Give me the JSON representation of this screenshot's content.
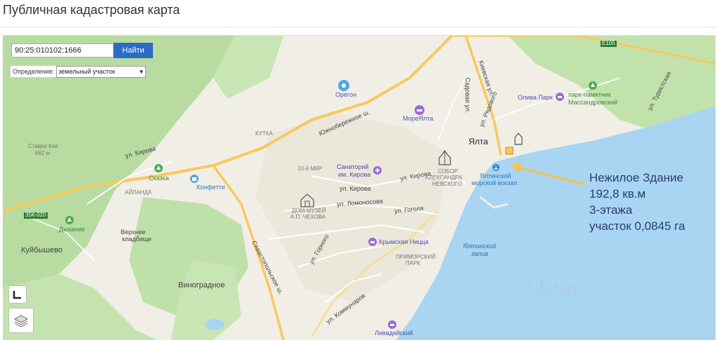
{
  "page": {
    "title": "Публичная кадастровая карта"
  },
  "search": {
    "value": "90:25:010102:1666",
    "button": "Найти"
  },
  "definition": {
    "label": "Определение:",
    "selected": "земельный участок"
  },
  "annotation": {
    "lines": [
      "Нежилое Здание",
      "192,8 кв.м",
      "3-этажа",
      "участок 0,0845 га"
    ]
  },
  "map_labels": {
    "yalta": "Ялта",
    "oregon": "Орегон",
    "more_yalta": "МореЯлта",
    "oliva_park": "Олива Парк",
    "massandra_1": "парк-памятник",
    "massandra_2": "Массандровский",
    "sanatorium_1": "Санаторий",
    "sanatorium_2": "им. Кирова",
    "sobor_1": "СОБОР",
    "sobor_2": "АЛЕКСАНДРА",
    "sobor_3": "НЕВСКОГО",
    "port_1": "Ялтинский",
    "port_2": "морской вокзал",
    "chekhov_1": "ДОМ-МУЗЕЙ",
    "chekhov_2": "А.П. ЧЕХОВА",
    "konfetti": "Конфетти",
    "skazka": "Сказка",
    "dykhanie": "Дыхание",
    "cemetery_1": "Верхнее",
    "cemetery_2": "кладбище",
    "kuibyshevo": "Куйбышево",
    "vinogradnoe": "Виноградное",
    "stavri_1": "Ставри Кая",
    "stavri_2": "662 м",
    "krymskaya_nitsa": "Крымская Ницца",
    "bay_1": "Ялтинский",
    "bay_2": "залив",
    "primorsky_1": "ПРИМОРСКИЙ",
    "primorsky_2": "ПАРК",
    "livadia": "Ливадийский",
    "ul_kirova_1": "ул. Кирова",
    "ul_kirova_2": "ул. Кирова",
    "ul_kirova_3": "ул. Кирова",
    "ul_lomonosova": "ул. Ломоносова",
    "ul_gogolya": "ул. Гоголя",
    "ul_gornogo": "ул. Горного",
    "ul_kommunarov": "ул. Коммунаров",
    "sevastopolskoe": "Севастопольское ш.",
    "yuzhnoberezhnoe": "Южнобережное ш.",
    "ul_ryadovskogo": "ул. Рядового",
    "ul_kievskaya": "Киевская ул.",
    "ul_sadovaya": "Садовая ул.",
    "ul_turist": "ул. Туристская",
    "kutka": "КУТКА",
    "mkr": "10-й МКР",
    "e105": "E105",
    "road_35k": "35К-020",
    "aylanda": "АЙЛАНДА"
  },
  "watermark": {
    "main": "Циан",
    "sub": "yalta.cian.ru"
  },
  "colors": {
    "sea": "#a9d4f2",
    "land": "#f1eee6",
    "forest": "#b7dba0",
    "road_major": "#f7c95c",
    "arrow": "#f4c44a",
    "button": "#2b6cc4"
  },
  "icons": {
    "controls": [
      "ruler-icon",
      "layers-icon"
    ]
  }
}
